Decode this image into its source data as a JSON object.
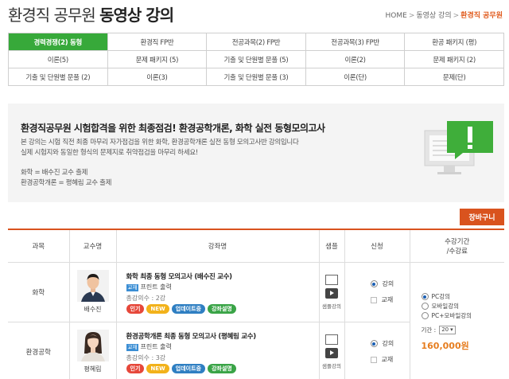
{
  "header": {
    "title_light": "환경직 공무원",
    "title_bold": "동영상 강의",
    "breadcrumb": [
      "HOME",
      "동영상 강의",
      "환경직 공무원"
    ]
  },
  "tabs": [
    [
      {
        "label": "경력경쟁(2) 동형",
        "active": true
      },
      {
        "label": "환경직 FP반"
      },
      {
        "label": "전공과목(2) FP반"
      },
      {
        "label": "전공과목(3) FP반"
      },
      {
        "label": "환공 패키지 (평)"
      }
    ],
    [
      {
        "label": "이론(5)"
      },
      {
        "label": "문제 패키지 (5)"
      },
      {
        "label": "기출 및 단원별 문풀 (5)"
      },
      {
        "label": "이론(2)"
      },
      {
        "label": "문제 패키지 (2)"
      }
    ],
    [
      {
        "label": "기출 및 단원별 문풀 (2)"
      },
      {
        "label": "이론(3)"
      },
      {
        "label": "기출 및 단원별 문풀 (3)"
      },
      {
        "label": "이론(단)"
      },
      {
        "label": "문제(단)"
      }
    ]
  ],
  "info": {
    "title": "환경직공무원 시험합격을 위한 최종점검! 환경공학개론, 화학 실전 동형모의고사",
    "desc1": "본 강의는 시험 직전 최종 마무리 자가점검을 위한 화학, 환경공학개론 실전 동형 모의고사반 강의입니다",
    "desc2": "실제 시험지와 동일한 형식의 문제지로 취약점검을 마무리 하세요!",
    "teacher1": "화학 = 배수진 교수 출제",
    "teacher2": "환경공학개론 = 평혜림 교수 출제"
  },
  "cart_label": "장바구니",
  "table": {
    "headers": {
      "subject": "과목",
      "professor": "교수명",
      "lecture": "강좌명",
      "sample": "샘플",
      "apply": "신청",
      "period_line1": "수강기간",
      "period_line2": "/수강료"
    },
    "rows": [
      {
        "subject": "화학",
        "professor": "배수진",
        "title": "화학 최종 동형 모의고사 (배수진 교수)",
        "material_badge": "교재",
        "material": "프린트 출력",
        "count": "총강의수 : 2강",
        "badges": [
          "인기",
          "NEW",
          "업데이트중",
          "강좌설명"
        ],
        "sample_label": "샘플강의",
        "apply_options": [
          "강의",
          "교재"
        ]
      },
      {
        "subject": "환경공학",
        "professor": "평혜림",
        "title": "환경공학개론 최종 동형 모의고사 (평혜림 교수)",
        "material_badge": "교재",
        "material": "프린트 출력",
        "count": "총강의수 : 3강",
        "badges": [
          "인기",
          "NEW",
          "업데이트중",
          "강좌설명"
        ],
        "sample_label": "샘플강의",
        "apply_options": [
          "강의",
          "교재"
        ]
      }
    ],
    "period": {
      "options": [
        "PC강의",
        "모바일강의",
        "PC+모바일강의"
      ],
      "selected": 0,
      "term_label": "기간 :",
      "term_value": "20",
      "price": "160,000원"
    }
  },
  "colors": {
    "tab_active": "#37a93a",
    "accent_orange": "#d9531e",
    "price": "#e67d1f",
    "badge_blue": "#3b8ed4"
  }
}
